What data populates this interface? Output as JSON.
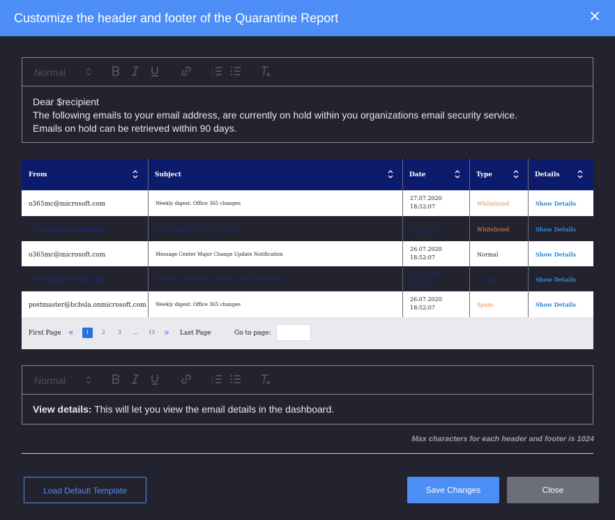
{
  "dialog": {
    "title": "Customize the header and footer of the Quarantine Report",
    "close_icon": "close-icon"
  },
  "editor_toolbar": {
    "format_select": "Normal",
    "icons": [
      "bold-icon",
      "italic-icon",
      "underline-icon",
      "link-icon",
      "ordered-list-icon",
      "bullet-list-icon",
      "clear-format-icon"
    ]
  },
  "header_editor": {
    "lines": [
      "Dear $recipient",
      "The following emails to your email address, are currently on hold within you organizations email security service.",
      "Emails on hold can be retrieved within 90 days."
    ]
  },
  "table": {
    "columns": [
      "From",
      "Subject",
      "Date",
      "Type",
      "Details"
    ],
    "rows": [
      {
        "from": "o365mc@microsoft.com",
        "subject": "Weekly digest: Office 365 changes",
        "date": "27.07.2020",
        "time": "18:52:07",
        "type": "Whitelisted",
        "type_color": "#f08a3c",
        "details": "Show Details",
        "style": "light"
      },
      {
        "from": "o365mc@microsoft.com",
        "subject": "Weekly digest: Office 365 changes",
        "date": "27.07.2020",
        "time": "18:52:07",
        "type": "Whitelisted",
        "type_color": "#f08a3c",
        "details": "Show Details",
        "style": "dark"
      },
      {
        "from": "o365mc@microsoft.com",
        "subject": "Message Center Major Change Update Notification",
        "date": "26.07.2020",
        "time": "18:52:07",
        "type": "Normal",
        "type_color": "#222222",
        "details": "Show Details",
        "style": "light"
      },
      {
        "from": "o365mc@microsoft.com",
        "subject": "Message Center Major Change Update Notification",
        "date": "26.07.2020",
        "time": "18:52:07",
        "type": "Normal",
        "type_color": "#1a2a7a",
        "details": "Show Details",
        "style": "dark"
      },
      {
        "from": "postmaster@bcbsla.onmicrosoft.com",
        "subject": "Weekly digest: Office 365 changes",
        "date": "26.07.2020",
        "time": "18:52:07",
        "type": "Spam",
        "type_color": "#f08a3c",
        "details": "Show Details",
        "style": "light"
      }
    ]
  },
  "pager": {
    "first": "First Page",
    "pages": [
      "1",
      "2",
      "3",
      "...",
      "13"
    ],
    "active_page": "1",
    "last": "Last Page",
    "goto_label": "Go to page:",
    "goto_value": ""
  },
  "footer_editor": {
    "bold_part": "View details:",
    "rest": " This will let you view the email details in the dashboard."
  },
  "note": "Max characters for each header and footer is 1024",
  "buttons": {
    "load_default": "Load Default Template",
    "save": "Save Changes",
    "close": "Close"
  },
  "colors": {
    "accent": "#4c8ef5",
    "table_header": "#0c1b6b",
    "link": "#2a8ad6",
    "warning": "#f08a3c"
  }
}
